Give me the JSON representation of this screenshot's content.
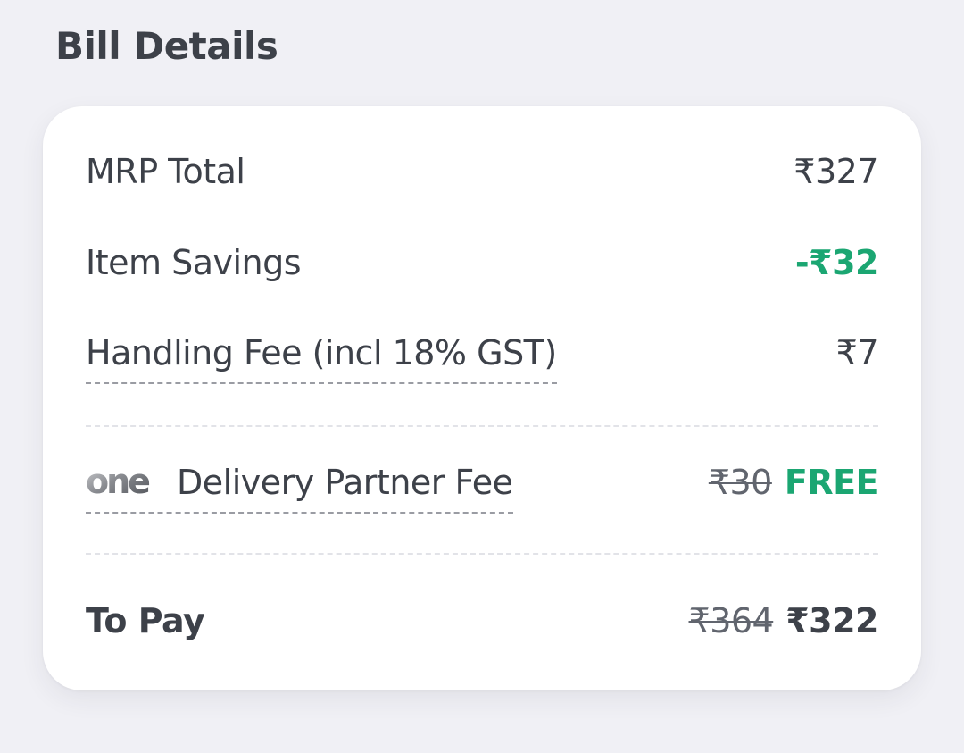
{
  "section_title": "Bill Details",
  "bill": {
    "mrp_total": {
      "label": "MRP Total",
      "value": "₹327"
    },
    "item_savings": {
      "label": "Item Savings",
      "value": "-₹32"
    },
    "handling_fee": {
      "label": "Handling Fee (incl 18% GST)",
      "value": "₹7"
    },
    "delivery_fee": {
      "logo_text": "one",
      "label": "Delivery Partner Fee",
      "original_value": "₹30",
      "value": "FREE"
    },
    "to_pay": {
      "label": "To Pay",
      "original_value": "₹364",
      "value": "₹322"
    }
  },
  "colors": {
    "text": "#3d4149",
    "savings_green": "#1ba672",
    "background": "#f0f0f5",
    "card": "#ffffff"
  }
}
